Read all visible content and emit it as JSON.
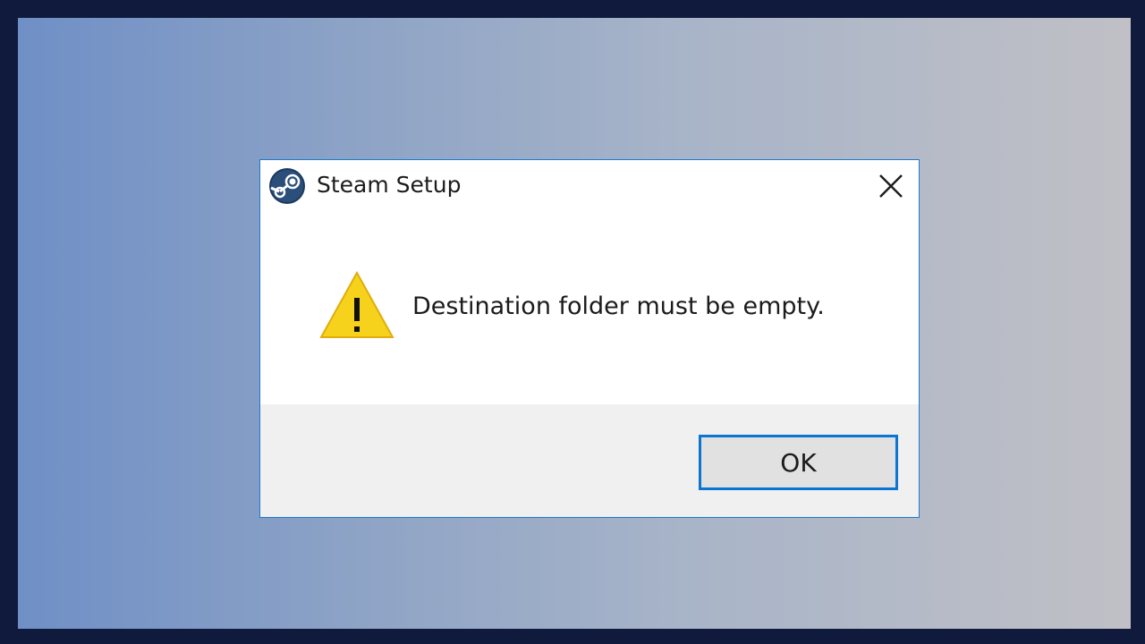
{
  "dialog": {
    "title": "Steam Setup",
    "message": "Destination folder must be empty.",
    "ok_label": "OK",
    "app_icon": "steam-logo-icon",
    "alert_icon": "warning-triangle-icon",
    "close_icon": "close-icon"
  },
  "colors": {
    "accent": "#0b75d1",
    "warning": "#f7d21c",
    "footer": "#f0f0f0"
  }
}
